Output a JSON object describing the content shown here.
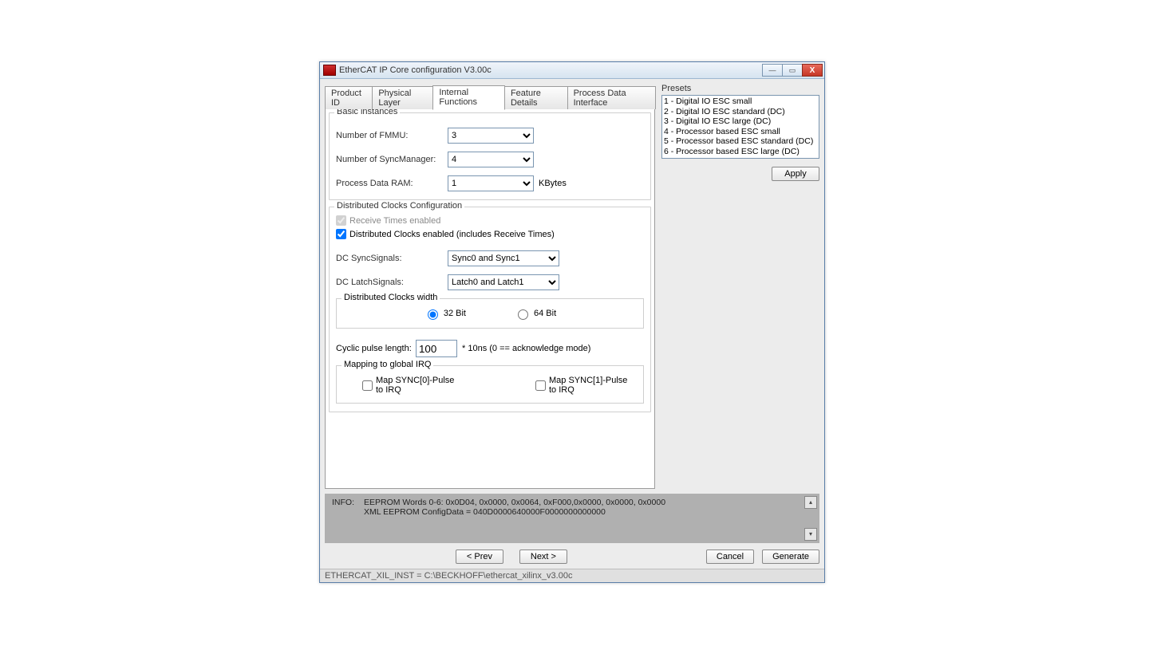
{
  "window": {
    "title": "EtherCAT IP Core configuration V3.00c"
  },
  "tabs": [
    {
      "label": "Product ID"
    },
    {
      "label": "Physical Layer"
    },
    {
      "label": "Internal Functions"
    },
    {
      "label": "Feature Details"
    },
    {
      "label": "Process Data Interface"
    }
  ],
  "basic": {
    "legend": "Basic instances",
    "fmmu_label": "Number of FMMU:",
    "fmmu_value": "3",
    "sm_label": "Number of SyncManager:",
    "sm_value": "4",
    "ram_label": "Process Data RAM:",
    "ram_value": "1",
    "ram_unit": "KBytes"
  },
  "dc": {
    "legend": "Distributed Clocks Configuration",
    "recv_label": "Receive Times enabled",
    "dc_enabled_label": "Distributed Clocks enabled (includes Receive Times)",
    "sync_label": "DC SyncSignals:",
    "sync_value": "Sync0 and Sync1",
    "latch_label": "DC LatchSignals:",
    "latch_value": "Latch0 and Latch1",
    "width_legend": "Distributed Clocks width",
    "width_32": "32 Bit",
    "width_64": "64 Bit",
    "cyclic_label": "Cyclic pulse length:",
    "cyclic_value": "100",
    "cyclic_suffix": "* 10ns (0 == acknowledge mode)",
    "irq_legend": "Mapping to global IRQ",
    "irq0_label": "Map SYNC[0]-Pulse to IRQ",
    "irq1_label": "Map SYNC[1]-Pulse to IRQ"
  },
  "presets": {
    "legend": "Presets",
    "items": [
      "1 - Digital IO ESC small",
      "2 - Digital IO ESC standard (DC)",
      "3 - Digital IO ESC large (DC)",
      "4 - Processor based ESC small",
      "5 - Processor based ESC standard (DC)",
      "6 - Processor based ESC large (DC)"
    ],
    "apply": "Apply"
  },
  "info": {
    "label": "INFO:",
    "line1": "EEPROM Words 0-6: 0x0D04, 0x0000, 0x0064, 0xF000,0x0000, 0x0000, 0x0000",
    "line2": "XML EEPROM ConfigData = 040D0000640000F0000000000000"
  },
  "buttons": {
    "prev": "< Prev",
    "next": "Next >",
    "cancel": "Cancel",
    "generate": "Generate"
  },
  "status": "ETHERCAT_XIL_INST = C:\\BECKHOFF\\ethercat_xilinx_v3.00c"
}
